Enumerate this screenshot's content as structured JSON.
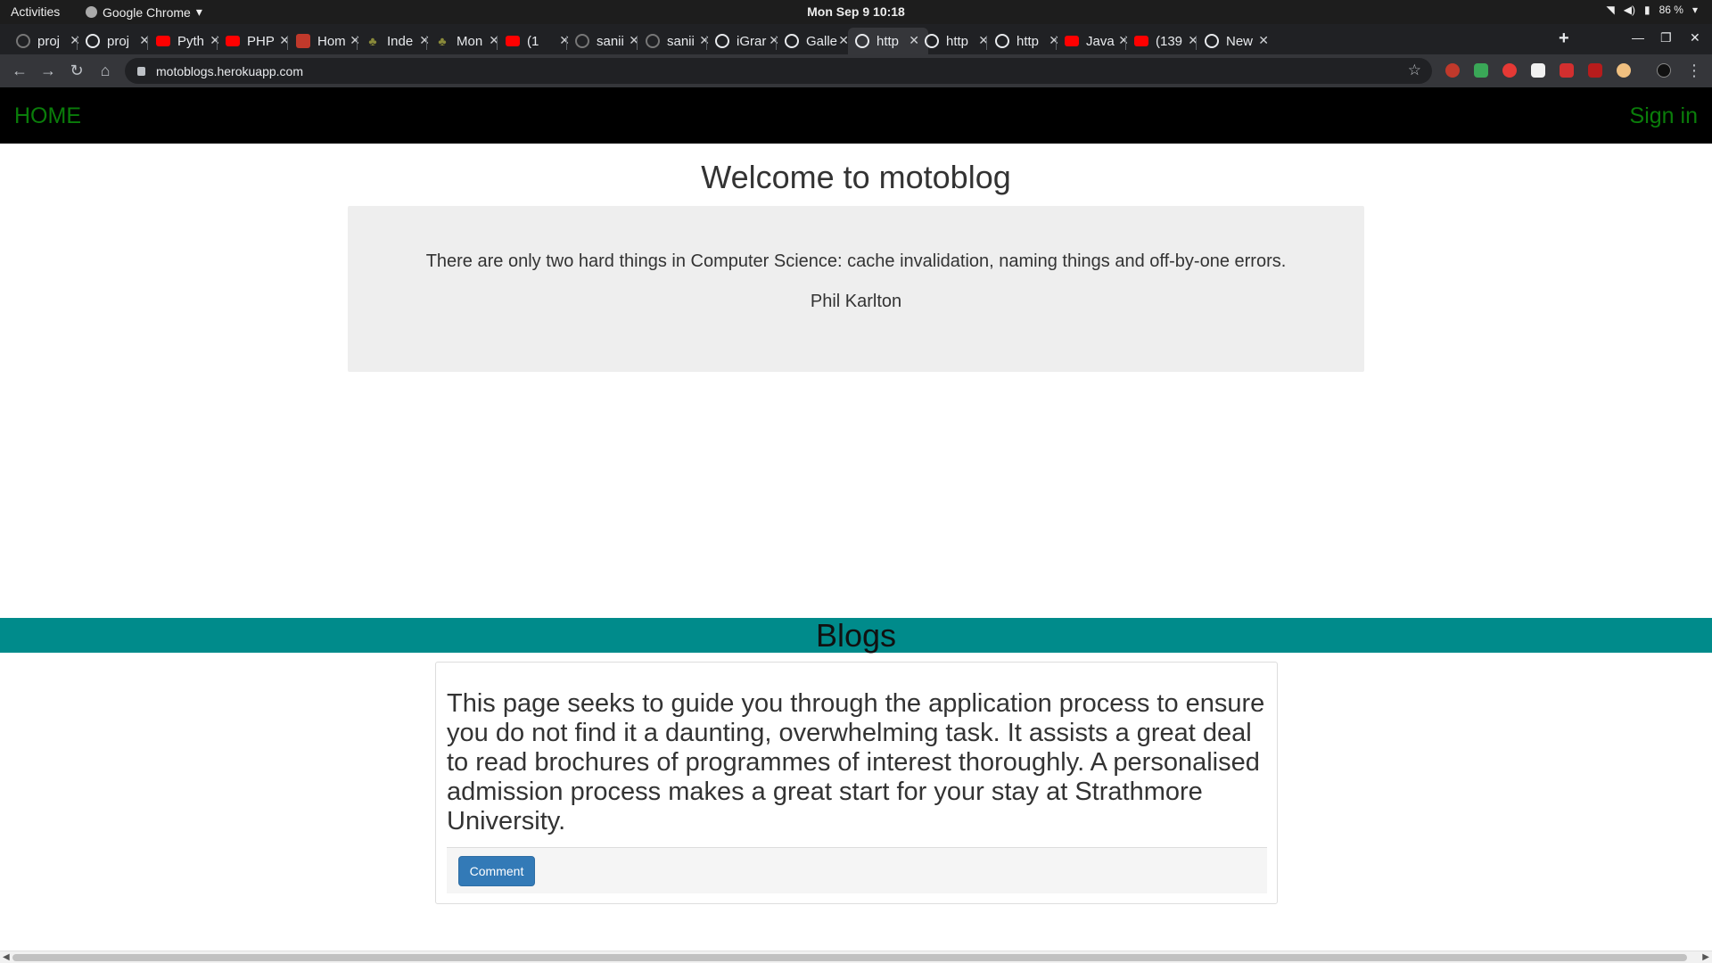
{
  "system_bar": {
    "activities": "Activities",
    "app_name": "Google Chrome",
    "clock": "Mon Sep 9  10:18",
    "battery": "86 %"
  },
  "tabs": [
    {
      "label": "proj",
      "icon": "github-icon"
    },
    {
      "label": "proj",
      "icon": "globe-icon"
    },
    {
      "label": "Pyth",
      "icon": "youtube-icon"
    },
    {
      "label": "PHP",
      "icon": "youtube-icon"
    },
    {
      "label": "Hom",
      "icon": "site-icon"
    },
    {
      "label": "Inde",
      "icon": "tree-icon"
    },
    {
      "label": "Mon",
      "icon": "tree-icon"
    },
    {
      "label": "(1",
      "icon": "youtube-icon"
    },
    {
      "label": "sanii",
      "icon": "github-icon"
    },
    {
      "label": "sanii",
      "icon": "github-icon"
    },
    {
      "label": "iGrar",
      "icon": "globe-icon"
    },
    {
      "label": "Galle",
      "icon": "globe-icon"
    },
    {
      "label": "http",
      "icon": "globe-icon"
    },
    {
      "label": "http",
      "icon": "globe-icon"
    },
    {
      "label": "http",
      "icon": "globe-icon"
    },
    {
      "label": "Java",
      "icon": "youtube-icon"
    },
    {
      "label": "(139",
      "icon": "youtube-icon"
    },
    {
      "label": "New",
      "icon": "globe-icon"
    }
  ],
  "active_tab_index": 12,
  "browser": {
    "url": "motoblogs.herokuapp.com"
  },
  "site": {
    "nav_home": "HOME",
    "nav_signin": "Sign in",
    "welcome": "Welcome to motoblog",
    "quote": "There are only two hard things in Computer Science: cache invalidation, naming things and off-by-one errors.",
    "quote_author": "Phil Karlton",
    "blogs_heading": "Blogs",
    "blog_post": "This page seeks to guide you through the application process to ensure you do not find it a daunting, overwhelming task. It assists a great deal to read brochures of programmes of interest thoroughly. A personalised admission process makes a great start for your stay at Strathmore University.",
    "comment_button": "Comment"
  },
  "colors": {
    "nav_link": "#0a7d0a",
    "blogs_bar": "#008b8b",
    "jumbotron": "#eeeeee",
    "button": "#337ab7"
  }
}
